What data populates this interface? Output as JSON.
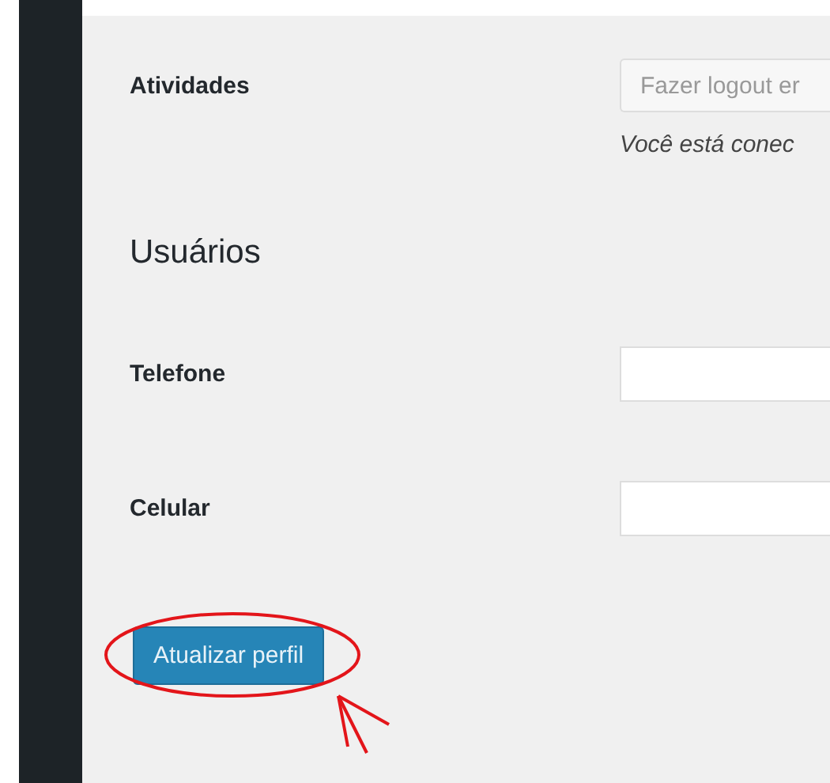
{
  "sessions": {
    "label": "Atividades",
    "button": "Fazer logout er",
    "note": "Você está conec"
  },
  "section": {
    "title": "Usuários"
  },
  "fields": [
    {
      "label": "Telefone"
    },
    {
      "label": "Celular"
    }
  ],
  "submit": {
    "label": "Atualizar perfil"
  }
}
